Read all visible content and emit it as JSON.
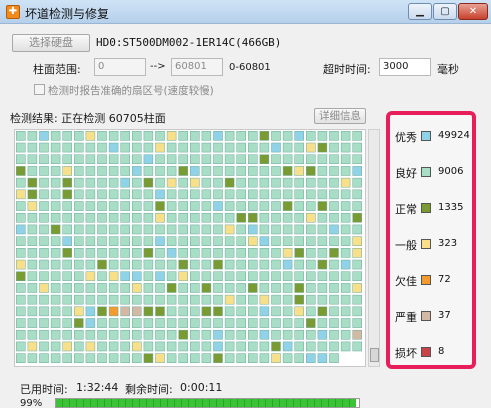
{
  "window": {
    "title": "坏道检测与修复",
    "icon": "app-icon",
    "controls": [
      "minimize-icon",
      "maximize-icon",
      "close-icon"
    ]
  },
  "disk": {
    "select_button": "选择硬盘",
    "name": "HD0:ST500DM002-1ER14C(466GB)"
  },
  "range": {
    "label": "柱面范围:",
    "from_value": "0",
    "arrow": "-->",
    "to_value": "60801",
    "range_text": "0-60801"
  },
  "timeout": {
    "label": "超时时间:",
    "value": "3000",
    "unit": "毫秒"
  },
  "option": {
    "label": "检测时报告准确的扇区号(速度较慢)",
    "checked": false
  },
  "result": {
    "label": "检测结果: 正在检测 60705柱面",
    "detail_button": "详细信息"
  },
  "colors": {
    "excellent": "#90d2e8",
    "good": "#a8ddc6",
    "normal": "#7a9a32",
    "average": "#f8e08a",
    "poor": "#f29b2e",
    "severe": "#d3b9a4",
    "damaged": "#c9434a",
    "legend_border": "#e81e5a",
    "progress": "#3cc236"
  },
  "legend": [
    {
      "label": "优秀",
      "count": "49924",
      "color": "#90d2e8"
    },
    {
      "label": "良好",
      "count": "9006",
      "color": "#a8ddc6"
    },
    {
      "label": "正常",
      "count": "1335",
      "color": "#7a9a32"
    },
    {
      "label": "一般",
      "count": "323",
      "color": "#f8e08a"
    },
    {
      "label": "欠佳",
      "count": "72",
      "color": "#f29b2e"
    },
    {
      "label": "严重",
      "count": "37",
      "color": "#d3b9a4"
    },
    {
      "label": "损坏",
      "count": "8",
      "color": "#c9434a"
    }
  ],
  "status": {
    "elapsed_label": "已用时间:",
    "elapsed": "1:32:44",
    "remaining_label": "剩余时间:",
    "remaining": "0:00:11"
  },
  "progress": {
    "percent": "99%",
    "value": 0.99
  }
}
